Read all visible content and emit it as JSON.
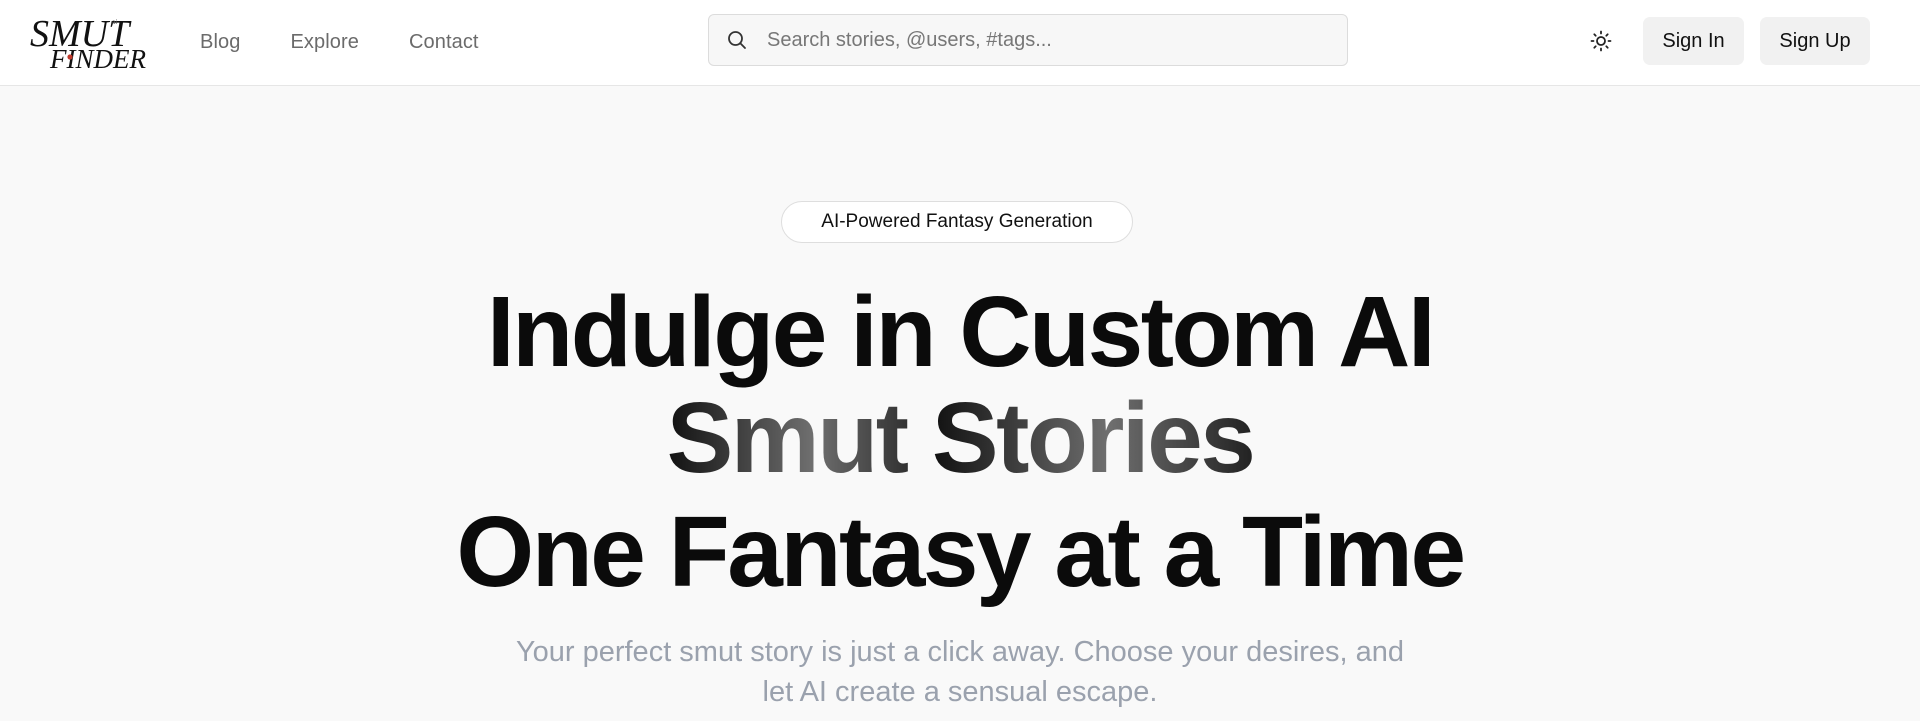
{
  "brand": {
    "line1": "SMUT",
    "line2": "FINDER",
    "tiny": "ai"
  },
  "nav": {
    "items": [
      "Blog",
      "Explore",
      "Contact"
    ]
  },
  "search": {
    "placeholder": "Search stories, @users, #tags..."
  },
  "header": {
    "theme_icon": "sun-icon",
    "sign_in_label": "Sign In",
    "sign_up_label": "Sign Up"
  },
  "hero": {
    "badge": "AI-Powered Fantasy Generation",
    "line1": "Indulge in Custom AI",
    "line2_a": "Smut ",
    "line2_b": "Stories",
    "line3": "One Fantasy at a Time",
    "sub_line1": "Your perfect smut story is just a click away. Choose your desires, and",
    "sub_line2": "let AI create a sensual escape."
  },
  "colors": {
    "page_bg": "#f9f9f9",
    "header_bg": "#ffffff",
    "text_dark": "#0b0b0b",
    "muted": "#9aa1ad",
    "button_bg": "#f1f1f1",
    "logo_accent": "#c0392b"
  }
}
